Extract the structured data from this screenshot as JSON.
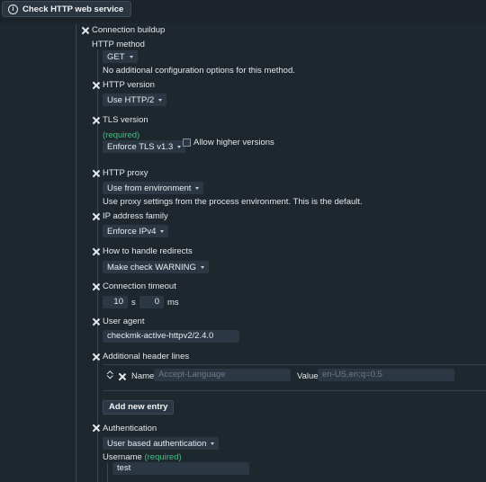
{
  "header": {
    "title": "Check HTTP web service",
    "icon": "info-icon"
  },
  "section": {
    "title": "Connection buildup"
  },
  "http_method": {
    "label": "HTTP method",
    "value": "GET",
    "note": "No additional configuration options for this method."
  },
  "http_version": {
    "label": "HTTP version",
    "value": "Use HTTP/2"
  },
  "tls_version": {
    "label": "TLS version",
    "required": "(required)",
    "value": "Enforce TLS v1.3",
    "allow_higher_label": "Allow higher versions",
    "allow_higher_checked": false
  },
  "http_proxy": {
    "label": "HTTP proxy",
    "value": "Use from environment",
    "note": "Use proxy settings from the process environment. This is the default."
  },
  "ip_family": {
    "label": "IP address family",
    "value": "Enforce IPv4"
  },
  "redirects": {
    "label": "How to handle redirects",
    "value": "Make check WARNING"
  },
  "timeout": {
    "label": "Connection timeout",
    "seconds": "10",
    "seconds_unit": "s",
    "ms": "0",
    "ms_unit": "ms"
  },
  "user_agent": {
    "label": "User agent",
    "value": "checkmk-active-httpv2/2.4.0"
  },
  "header_lines": {
    "label": "Additional header lines",
    "name_label": "Name",
    "name_placeholder": "Accept-Language",
    "value_label": "Value",
    "value_placeholder": "en-US,en;q=0.5",
    "add_label": "Add new entry"
  },
  "authentication": {
    "label": "Authentication",
    "value": "User based authentication",
    "username_label": "Username",
    "username_required": "(required)",
    "username_value": "test"
  },
  "colors": {
    "background": "#1e262e",
    "field": "#2b3743",
    "required": "#3cc480"
  }
}
